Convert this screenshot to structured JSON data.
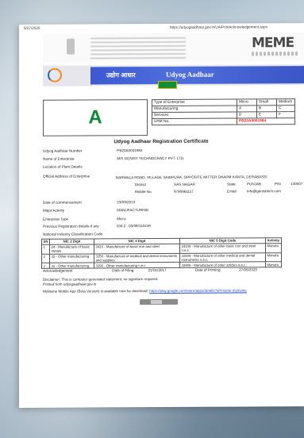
{
  "header": {
    "date": "6/27/2020",
    "url": "https://udyogaadhaar.gov.in/UA/PrintAcknowledgement.aspx"
  },
  "logos": {
    "meme_text": "MEME",
    "udyog_brand": "Udyog Aadhaar",
    "hindi_brand": "उद्योग आधार",
    "accent_color": "#3c5ad0",
    "grade_color": "#0a8a35",
    "uam_color": "#e1261c"
  },
  "grade": "A",
  "enterprise_table": {
    "rows": [
      {
        "label": "Type of Enterprise",
        "c1": "Micro",
        "c2": "Small",
        "c3": "Medium"
      },
      {
        "label": "Manufacturing",
        "c1": "A",
        "c2": "B",
        "c3": "C"
      },
      {
        "label": "Services",
        "c1": "D",
        "c2": "E",
        "c3": "F"
      }
    ],
    "uam_label": "UAM No.",
    "uam_value": "PB20A0001984"
  },
  "certificate": {
    "title": "Udyog Aadhaar Registration Certificate",
    "fields": [
      {
        "key": "Udyog Aadhaar Number",
        "value": "PB20A0001984"
      },
      {
        "key": "Name of Enterprise",
        "value": "M/S GENIST TECHNOCRACY PVT. LTD."
      },
      {
        "key": "Location of Plant Details",
        "value": ""
      },
      {
        "key": "Official Address of Enterprise",
        "value": ""
      }
    ],
    "address": "BARWALA ROAD, VILLAGE SAIDPURA, OPPOSITE MITTER DHARM KANTA, DERABASSI",
    "district_label": "District",
    "district": "SAS NAGAR",
    "state_label": "State",
    "state": "PUNJAB",
    "pin_label": "PIN",
    "pin": "140507",
    "mobile_label": "Mobile No",
    "mobile": "9780861117",
    "email_label": "Email:",
    "email": "info@genisttech.com",
    "fields2": [
      {
        "key": "Date of commencement",
        "value": "23/09/2013"
      },
      {
        "key": "Major Activity",
        "value": "MANUFACTURING"
      },
      {
        "key": "Enterprise Type",
        "value": "Micro"
      },
      {
        "key": "Previous Registration details-if any",
        "value": "EM-2 : 03/08/110449"
      },
      {
        "key": "National Industry Classification Code",
        "value": ""
      }
    ]
  },
  "nic_table": {
    "headers": [
      "SN",
      "NIC 2 Digit",
      "NIC 4 Digit",
      "NIC 5 Digit Code",
      "Activity"
    ],
    "rows": [
      [
        "1",
        "24 - Manufacture of basic metals",
        "2410 - Manufacture of basic iron and steel",
        "24109 - Manufacture of other basic iron and steel n.e.c",
        "Manufa"
      ],
      [
        "2",
        "32 - Other manufacturing",
        "3250 - Manufacture of medical and dental instruments and supplies",
        "32509 - Manufacture of other medical and dental instruments n.e.c.",
        "Manufa"
      ],
      [
        "3",
        "32 - Other manufacturing",
        "3290 - Other manufacturing n.e.c.",
        "32909 - Manufacture of other articles n.e.c.",
        "Manufa"
      ]
    ]
  },
  "ack": {
    "label": "Acknowledgement",
    "filing_label": "Date of Filing",
    "filing_date": "21/01/2017",
    "printing_label": "Date of Printing",
    "printing_date": "27/06/2020"
  },
  "footer": {
    "disclaimer": "Disclaimer: This is computer generated statement, no signature required.",
    "printed": "Printed from udyogaadhaar.gov.in",
    "app_text": "MyMsme Mobile App (Beta Version) is available now for download:",
    "app_link": "https://play.google.com/store/apps/details?id=msme.mymsme"
  }
}
